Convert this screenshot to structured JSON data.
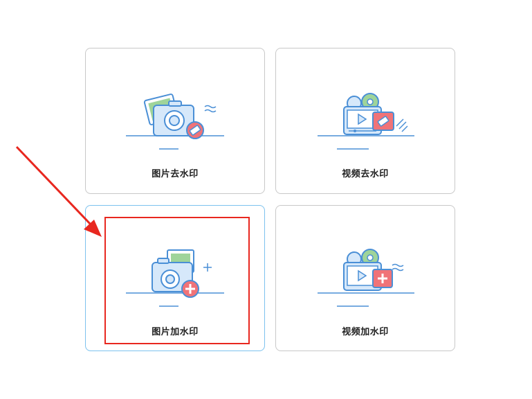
{
  "cards": [
    {
      "label": "图片去水印",
      "icon": "photo-camera-eraser-icon"
    },
    {
      "label": "视频去水印",
      "icon": "video-player-eraser-icon"
    },
    {
      "label": "图片加水印",
      "icon": "photo-camera-add-icon",
      "selected": true
    },
    {
      "label": "视频加水印",
      "icon": "video-player-add-icon"
    }
  ],
  "colors": {
    "icon_stroke": "#4a8fd6",
    "icon_fill": "#d6e8fa",
    "badge_red": "#f07378",
    "film_green": "#9fd49a",
    "selected_border": "#7cc2ee",
    "annotation_red": "#e8271f"
  }
}
